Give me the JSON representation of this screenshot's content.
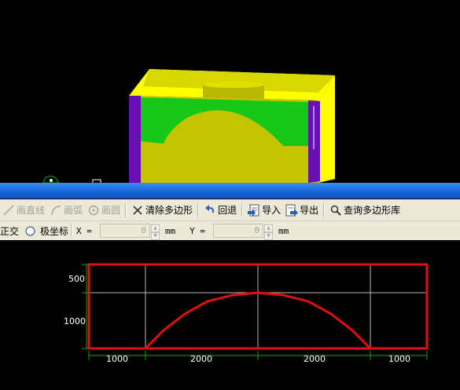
{
  "toolbar": {
    "draw_line": "画直线",
    "draw_arc": "画弧",
    "draw_circle": "画圆",
    "clear_polygon": "清除多边形",
    "undo": "回退",
    "import": "导入",
    "export": "导出",
    "query_library": "查询多边形库"
  },
  "coords": {
    "ortho": "正交",
    "polar": "极坐标",
    "x_label": "X =",
    "x_value": "0",
    "x_unit": "mm",
    "y_label": "Y =",
    "y_value": "0",
    "y_unit": "mm"
  },
  "profile": {
    "left_dims": [
      "500",
      "1000"
    ],
    "bottom_dims": [
      "1000",
      "2000",
      "2000",
      "1000"
    ],
    "colors": {
      "frame": "#e01010",
      "grid": "#b8b8b8",
      "dim": "#1aa01a"
    }
  },
  "colors": {
    "titlebar": "#1463d8",
    "toolbar_bg": "#ece9d8",
    "model_yellow": "#c8c800",
    "model_green": "#18c818",
    "model_purple": "#6a10b0"
  }
}
